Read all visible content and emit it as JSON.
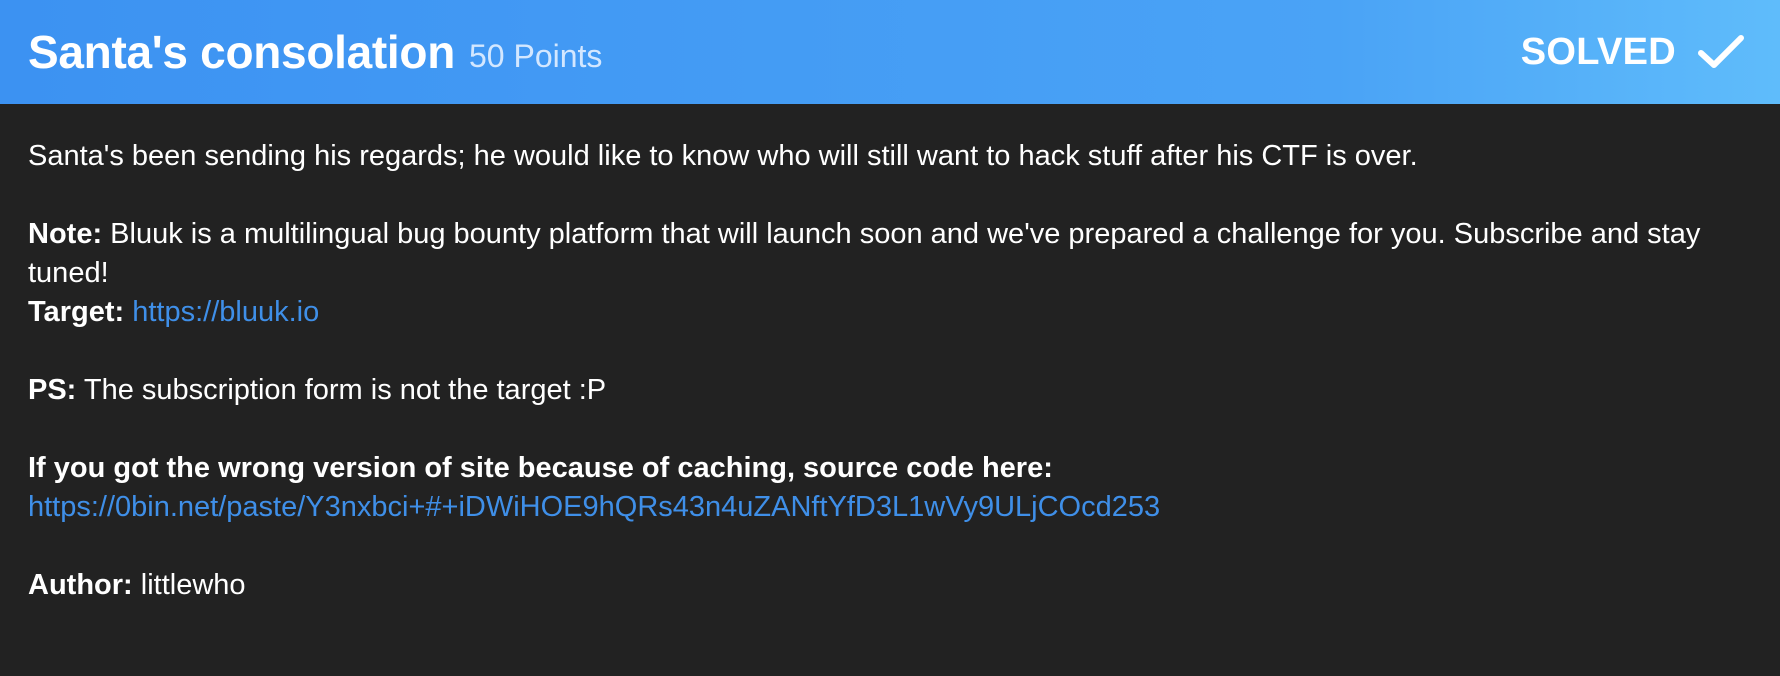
{
  "header": {
    "title": "Santa's consolation",
    "points": "50 Points",
    "status": "SOLVED",
    "status_icon": "checkmark-icon",
    "gradient_start": "#3c92f2",
    "gradient_end": "#5fbcfb"
  },
  "body": {
    "description": "Santa's been sending his regards; he would like to know who will still want to hack stuff after his CTF is over.",
    "note_label": "Note:",
    "note_text": " Bluuk is a multilingual bug bounty platform that will launch soon and we've prepared a challenge for you. Subscribe and stay tuned!",
    "target_label": "Target:",
    "target_link": "https://bluuk.io",
    "ps_label": "PS:",
    "ps_text": " The subscription form is not the target :P",
    "caching_text": "If you got the wrong version of site because of caching, source code here:",
    "source_link": "https://0bin.net/paste/Y3nxbci+#+iDWiHOE9hQRs43n4uZANftYfD3L1wVy9ULjCOcd253",
    "author_label": "Author:",
    "author_name": " littlewho"
  },
  "colors": {
    "background": "#222222",
    "link": "#3f8fe8",
    "text": "#ffffff"
  }
}
